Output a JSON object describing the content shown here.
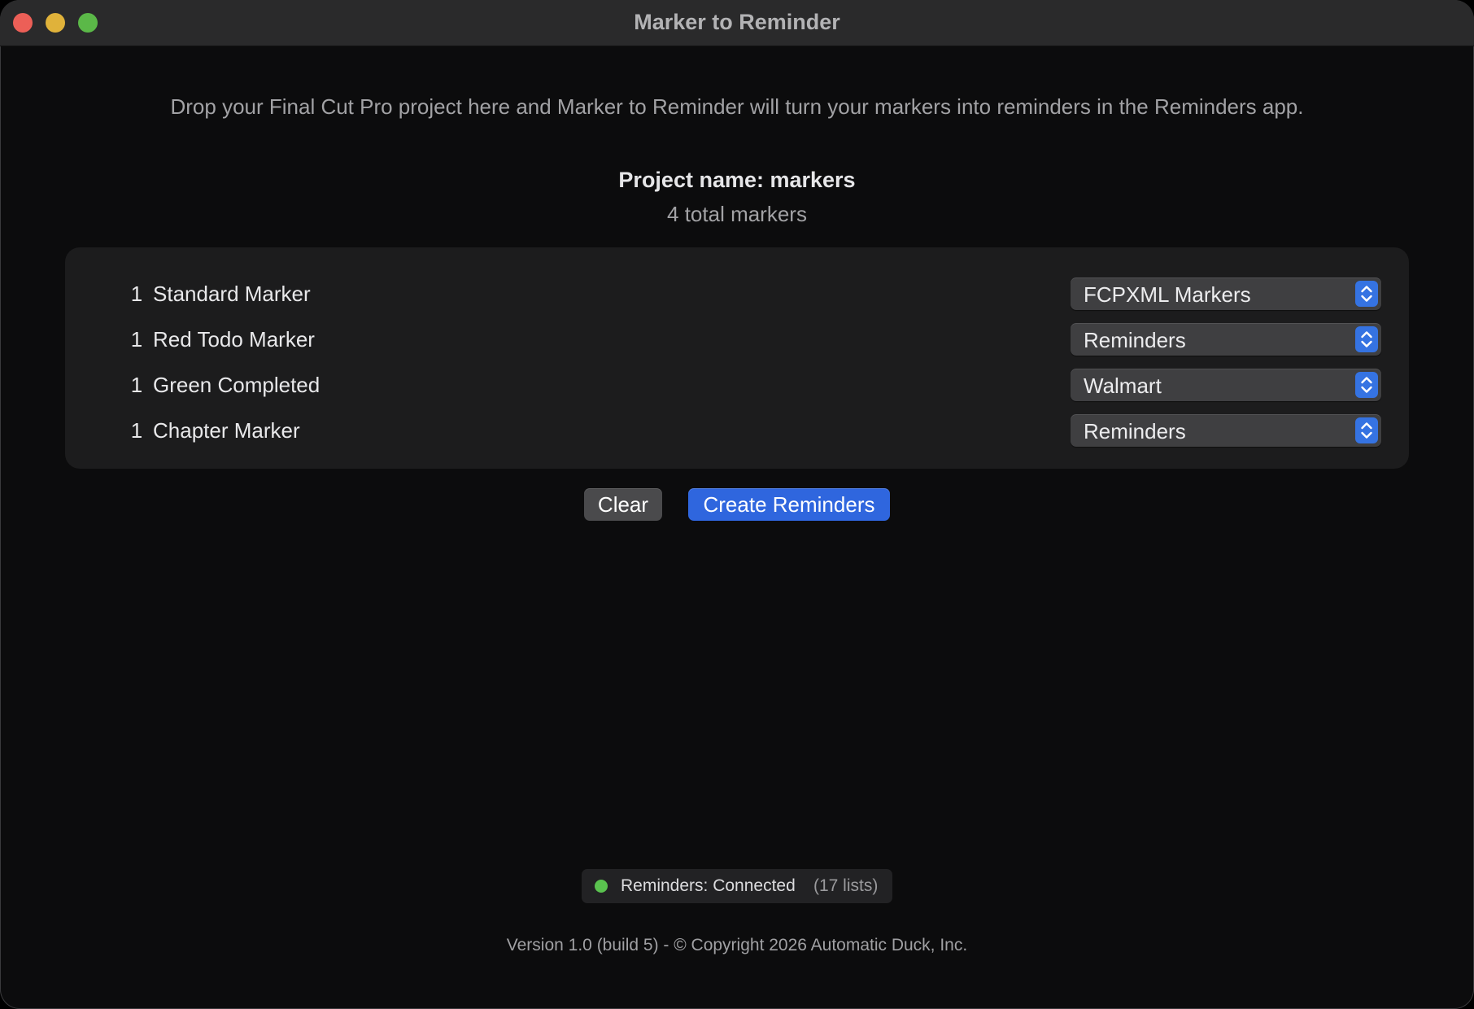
{
  "window": {
    "title": "Marker to Reminder"
  },
  "main": {
    "instructions": "Drop your Final Cut Pro project here and Marker to Reminder will turn your markers into reminders in the Reminders app.",
    "project_name": "Project name: markers",
    "total_markers": "4 total markers"
  },
  "markers": [
    {
      "count": "1",
      "name": "Standard Marker",
      "list": "FCPXML Markers"
    },
    {
      "count": "1",
      "name": "Red Todo Marker",
      "list": "Reminders"
    },
    {
      "count": "1",
      "name": "Green Completed",
      "list": "Walmart"
    },
    {
      "count": "1",
      "name": "Chapter Marker",
      "list": "Reminders"
    }
  ],
  "actions": {
    "clear_label": "Clear",
    "create_label": "Create Reminders"
  },
  "status": {
    "text": "Reminders: Connected",
    "count": "(17 lists)",
    "indicator_color": "#5ac24f"
  },
  "footer": {
    "text": "Version 1.0 (build 5) - © Copyright 2026 Automatic Duck, Inc."
  },
  "colors": {
    "accent": "#2f66de",
    "background": "#0c0c0d",
    "panel": "#1c1c1d"
  },
  "icons": {
    "popup_stepper": "chevron-up-down-icon",
    "status": "green-dot-icon"
  }
}
